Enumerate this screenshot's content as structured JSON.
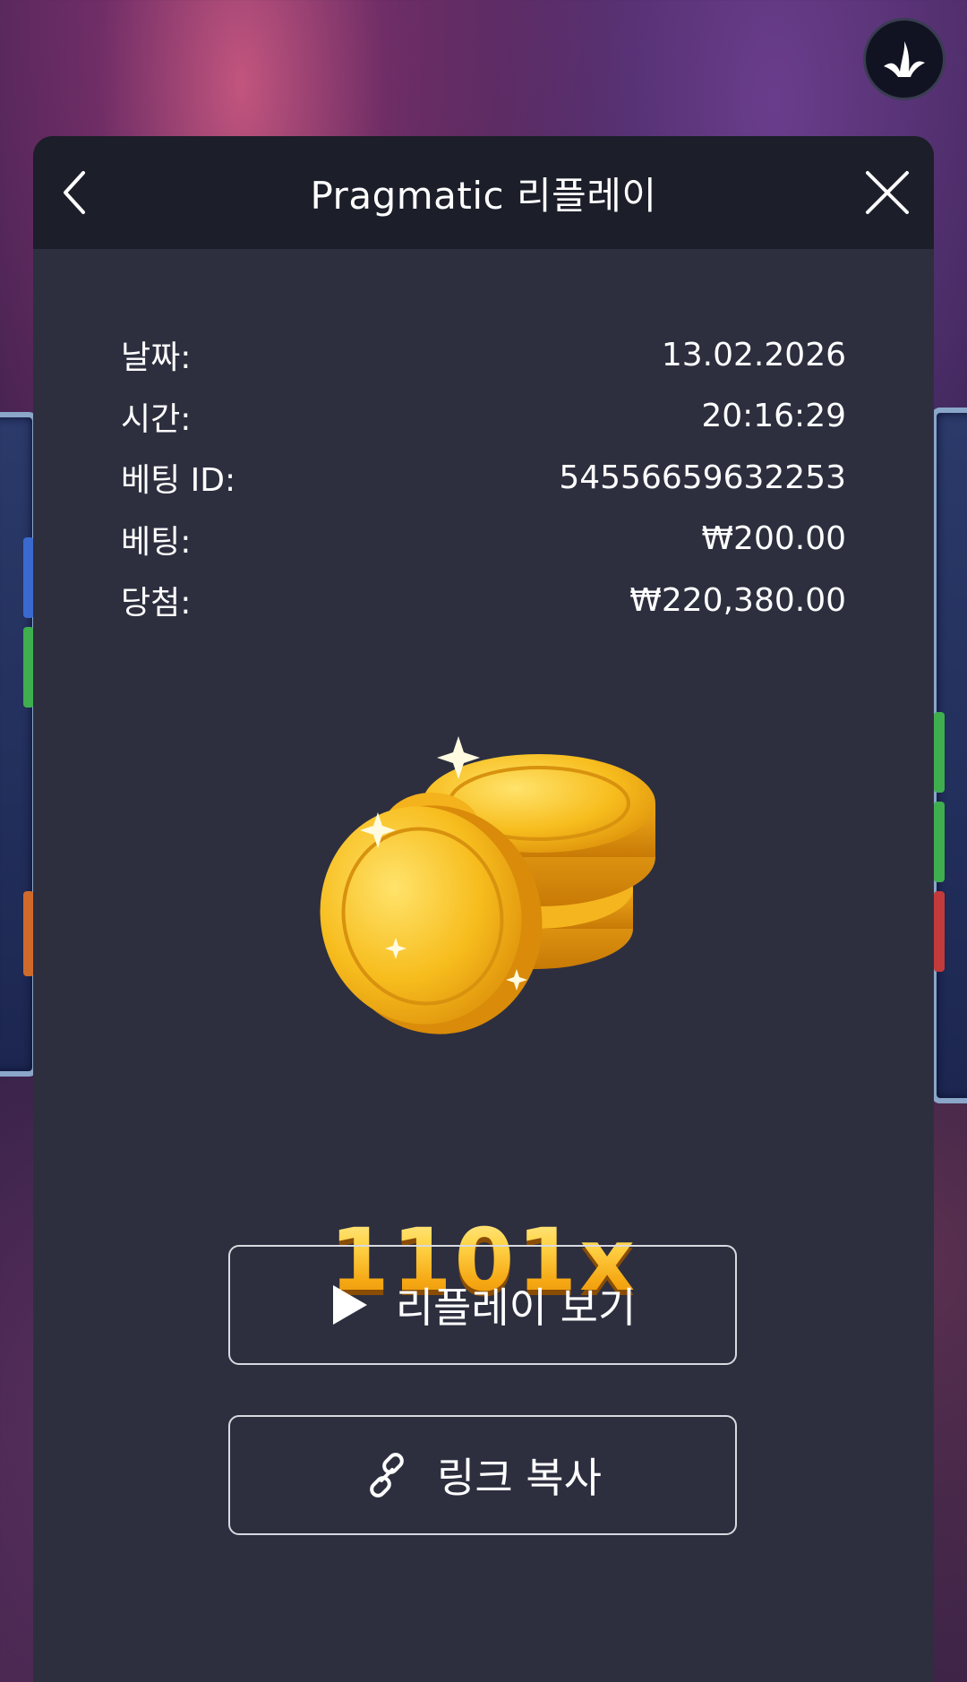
{
  "header": {
    "title": "Pragmatic 리플레이",
    "back_icon": "chevron-left-icon",
    "close_icon": "close-icon"
  },
  "brand": {
    "icon": "brand-logo-icon"
  },
  "details": [
    {
      "label": "날짜:",
      "value": "13.02.2026"
    },
    {
      "label": "시간:",
      "value": "20:16:29"
    },
    {
      "label": "베팅 ID:",
      "value": "54556659632253"
    },
    {
      "label": "베팅:",
      "value": "₩200.00"
    },
    {
      "label": "당첨:",
      "value": "₩220,380.00"
    }
  ],
  "win": {
    "multiplier": "1101x",
    "image_icon": "gold-coins-icon"
  },
  "actions": {
    "watch_replay_label": "리플레이 보기",
    "watch_replay_icon": "play-icon",
    "copy_link_label": "링크 복사",
    "copy_link_icon": "link-icon"
  },
  "colors": {
    "panel_bg": "#2d2f3f",
    "header_bg": "#1c1e2a",
    "text": "#ffffff",
    "accent_gold": "#f7b625"
  }
}
